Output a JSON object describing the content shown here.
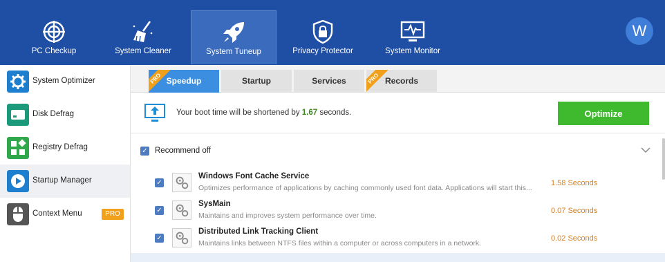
{
  "topnav": {
    "items": [
      {
        "label": "PC Checkup",
        "icon": "target-icon"
      },
      {
        "label": "System Cleaner",
        "icon": "broom-icon"
      },
      {
        "label": "System Tuneup",
        "icon": "rocket-icon",
        "active": true
      },
      {
        "label": "Privacy Protector",
        "icon": "shield-lock-icon"
      },
      {
        "label": "System Monitor",
        "icon": "monitor-pulse-icon"
      }
    ],
    "avatar_letter": "W"
  },
  "sidebar": {
    "items": [
      {
        "label": "System Optimizer",
        "icon": "gear-icon",
        "color": "#1e7fcf"
      },
      {
        "label": "Disk Defrag",
        "icon": "disk-icon",
        "color": "#1a9a7a"
      },
      {
        "label": "Registry Defrag",
        "icon": "blocks-icon",
        "color": "#2ea84a"
      },
      {
        "label": "Startup Manager",
        "icon": "play-icon",
        "color": "#1e7fcf",
        "active": true
      },
      {
        "label": "Context Menu",
        "icon": "mouse-icon",
        "color": "#555555",
        "badge": "PRO"
      }
    ]
  },
  "tabs": [
    {
      "label": "Speedup",
      "active": true,
      "ribbon": "PRO"
    },
    {
      "label": "Startup"
    },
    {
      "label": "Services"
    },
    {
      "label": "Records",
      "ribbon": "PRO"
    }
  ],
  "boot": {
    "text_before": "Your boot time will be shortened by ",
    "value": "1.67",
    "text_after": " seconds.",
    "optimize_label": "Optimize"
  },
  "recommend": {
    "label": "Recommend off",
    "checked": true
  },
  "services": [
    {
      "name": "Windows Font Cache Service",
      "description": "Optimizes performance of applications by caching commonly used font data. Applications will start this...",
      "time": "1.58 Seconds",
      "checked": true
    },
    {
      "name": "SysMain",
      "description": "Maintains and improves system performance over time.",
      "time": "0.07 Seconds",
      "checked": true
    },
    {
      "name": "Distributed Link Tracking Client",
      "description": "Maintains links between NTFS files within a computer or across computers in a network.",
      "time": "0.02 Seconds",
      "checked": true
    }
  ],
  "colors": {
    "header": "#1e4fa5",
    "accent": "#3b8ee0",
    "optimize": "#3fba2e",
    "pro": "#f0a01a",
    "time": "#d9801a"
  }
}
